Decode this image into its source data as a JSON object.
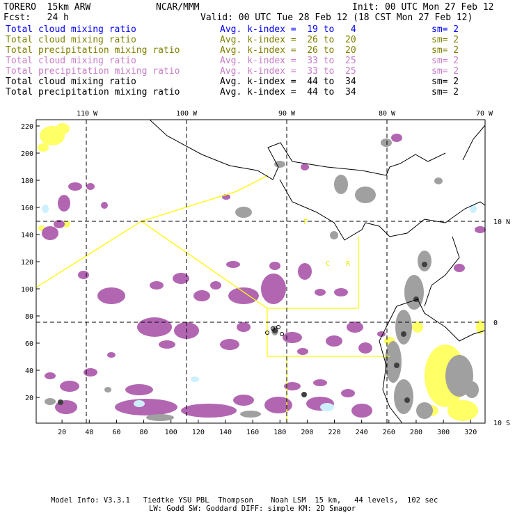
{
  "header": {
    "model": "TORERO  15km ARW",
    "org": "NCAR/MMM",
    "init": "Init: 00 UTC Mon 27 Feb 12",
    "fcst": "Fcst:   24 h",
    "valid": "Valid: 00 UTC Tue 28 Feb 12 (18 CST Mon 27 Feb 12)"
  },
  "legend": [
    {
      "field": "Total cloud mixing ratio",
      "range": "Avg. k-index =  19 to   4",
      "sm": "sm= 2",
      "color": "#0000ff"
    },
    {
      "field": "Total cloud mixing ratio",
      "range": "Avg. k-index =  26 to  20",
      "sm": "sm= 2",
      "color": "#7f7f00"
    },
    {
      "field": "Total precipitation mixing ratio",
      "range": "Avg. k-index =  26 to  20",
      "sm": "sm= 2",
      "color": "#7f7f00"
    },
    {
      "field": "Total cloud mixing ratio",
      "range": "Avg. k-index =  33 to  25",
      "sm": "sm= 2",
      "color": "#c87dc8"
    },
    {
      "field": "Total precipitation mixing ratio",
      "range": "Avg. k-index =  33 to  25",
      "sm": "sm= 2",
      "color": "#c87dc8"
    },
    {
      "field": "Total cloud mixing ratio",
      "range": "Avg. k-index =  44 to  34",
      "sm": "sm= 2",
      "color": "#000000"
    },
    {
      "field": "Total precipitation mixing ratio",
      "range": "Avg. k-index =  44 to  34",
      "sm": "sm= 2",
      "color": "#000000"
    }
  ],
  "map": {
    "top_labels": [
      "110 W",
      "100 W",
      "90 W",
      "80 W",
      "70 W"
    ],
    "right_labels": [
      "10 N",
      "0",
      "10 S"
    ],
    "x_ticks": [
      "20",
      "40",
      "60",
      "80",
      "100",
      "120",
      "140",
      "160",
      "180",
      "200",
      "220",
      "240",
      "260",
      "280",
      "300",
      "320"
    ],
    "y_ticks": [
      "220",
      "200",
      "180",
      "160",
      "140",
      "120",
      "100",
      "80",
      "60",
      "40",
      "20"
    ],
    "region_labels": [
      "F",
      "C",
      "R"
    ]
  },
  "footer": {
    "line1": "Model Info: V3.3.1   Tiedtke YSU PBL  Thompson    Noah LSM  15 km,   44 levels,  102 sec",
    "line2": "LW: Godd SW: Goddard DIFF: simple KM: 2D Smagor"
  },
  "colors": {
    "yellow": "#ffff66",
    "purple": "#b266b2",
    "gray": "#a0a0a0",
    "cyan": "#ccf0ff"
  }
}
